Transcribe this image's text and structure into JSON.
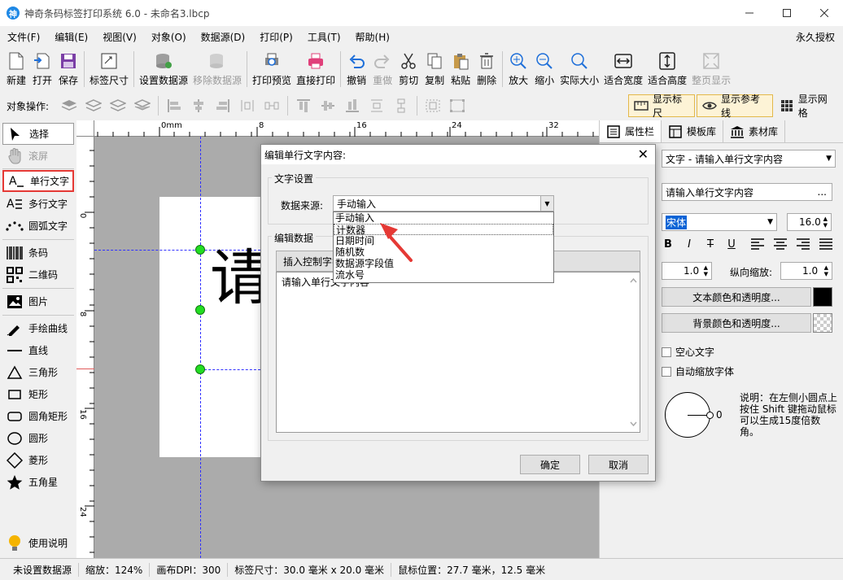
{
  "window": {
    "title": "神奇条码标签打印系统 6.0 - 未命名3.lbcp",
    "app_icon_glyph": "神"
  },
  "menu": {
    "items": [
      "文件(F)",
      "编辑(E)",
      "视图(V)",
      "对象(O)",
      "数据源(D)",
      "打印(P)",
      "工具(T)",
      "帮助(H)"
    ],
    "right": "永久授权"
  },
  "toolbar": {
    "new": "新建",
    "open": "打开",
    "save": "保存",
    "label_size": "标签尺寸",
    "set_datasource": "设置数据源",
    "remove_datasource": "移除数据源",
    "print_preview": "打印预览",
    "direct_print": "直接打印",
    "undo": "撤销",
    "redo": "重做",
    "cut": "剪切",
    "copy": "复制",
    "paste": "粘贴",
    "delete": "删除",
    "zoom_in": "放大",
    "zoom_out": "缩小",
    "actual_size": "实际大小",
    "fit_width": "适合宽度",
    "fit_height": "适合高度",
    "full_page": "整页显示"
  },
  "ops": {
    "label": "对象操作:",
    "show_ruler": "显示标尺",
    "show_guides": "显示参考线",
    "show_grid": "显示网格"
  },
  "left_tools": {
    "select": "选择",
    "scroll": "滚屏",
    "single_text": "单行文字",
    "multi_text": "多行文字",
    "arc_text": "圆弧文字",
    "barcode": "条码",
    "qrcode": "二维码",
    "image": "图片",
    "freehand": "手绘曲线",
    "line": "直线",
    "triangle": "三角形",
    "rect": "矩形",
    "round_rect": "圆角矩形",
    "circle": "圆形",
    "diamond": "菱形",
    "star": "五角星",
    "help": "使用说明"
  },
  "ruler": {
    "top": [
      "0mm",
      "8",
      "16",
      "24",
      "32"
    ],
    "left": [
      "0",
      "8",
      "16",
      "24"
    ]
  },
  "canvas": {
    "char": "请"
  },
  "right_panel": {
    "tabs": [
      "属性栏",
      "模板库",
      "素材库"
    ],
    "object_combo": "文字 - 请输入单行文字内容",
    "content_value": "请输入单行文字内容",
    "content_btn": "...",
    "font_name": "宋体",
    "font_size": "16.0",
    "bold": "B",
    "italic": "I",
    "strike": "T",
    "underline": "U",
    "hscale_value": "1.0",
    "vscale_label": "纵向缩放:",
    "vscale_value": "1.0",
    "text_color_btn": "文本颜色和透明度...",
    "bg_color_btn": "背景颜色和透明度...",
    "hollow_text": "空心文字",
    "auto_shrink": "自动缩放字体",
    "rotation_value": "0",
    "rotation_hint": "说明：在左侧小圆点上按住 Shift 键拖动鼠标可以生成15度倍数角。",
    "text_color": "#000000"
  },
  "dialog": {
    "title": "编辑单行文字内容:",
    "close": "✕",
    "group_text_settings": "文字设置",
    "datasource_label": "数据来源:",
    "datasource_value": "手动输入",
    "dropdown_options": [
      "手动输入",
      "计数器",
      "日期时间",
      "随机数",
      "数据源字段值",
      "流水号"
    ],
    "group_edit_data": "编辑数据",
    "insert_ctrl_btn": "插入控制字符",
    "textarea_value": "请输入单行文字内容",
    "ok": "确定",
    "cancel": "取消"
  },
  "status": {
    "datasource": "未设置数据源",
    "zoom": "缩放：124%",
    "dpi": "画布DPI：300",
    "label_size": "标签尺寸：30.0 毫米 x 20.0 毫米",
    "mouse_pos": "鼠标位置：27.7 毫米，12.5 毫米"
  }
}
